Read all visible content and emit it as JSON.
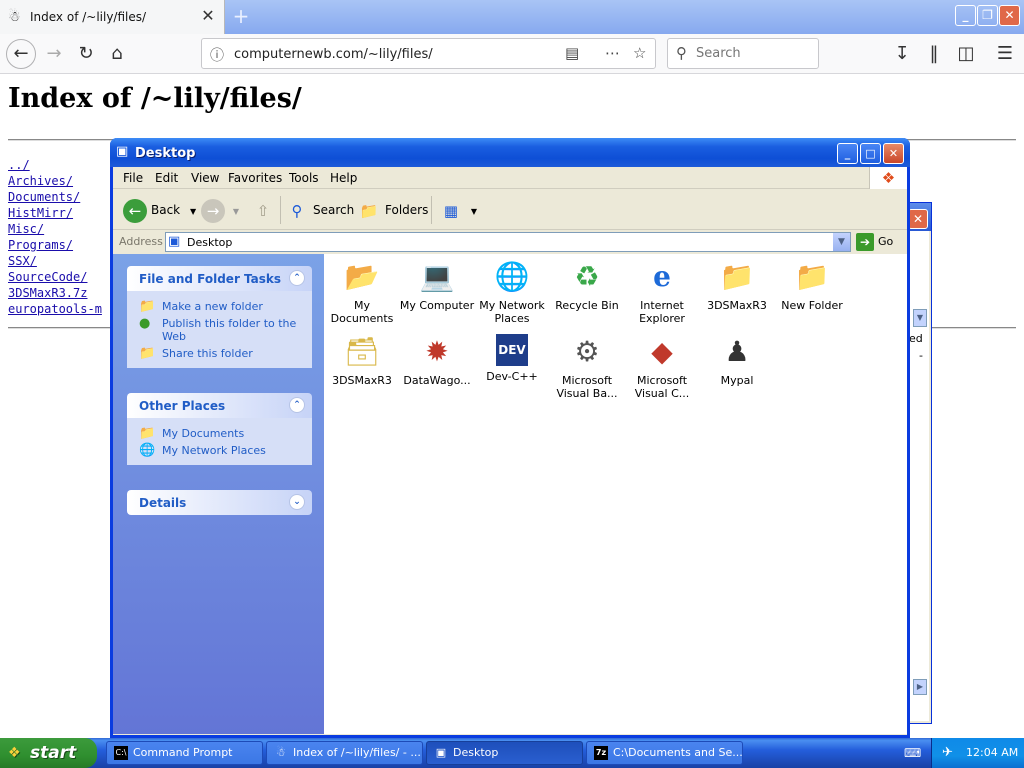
{
  "browser": {
    "tab_title": "Index of /~lily/files/",
    "url": "computernewb.com/~lily/files/",
    "search_placeholder": "Search",
    "page_heading": "Index of /~lily/files/",
    "listing": [
      "../",
      "Archives/",
      "Documents/",
      "HistMirr/",
      "Misc/",
      "Programs/",
      "SSX/",
      "SourceCode/",
      "3DSMaxR3.7z",
      "europatools-m"
    ]
  },
  "background_window": {
    "fragment_text_1": "ed",
    "fragment_text_2": "-"
  },
  "explorer": {
    "title": "Desktop",
    "menu": [
      "File",
      "Edit",
      "View",
      "Favorites",
      "Tools",
      "Help"
    ],
    "toolbar": {
      "back": "Back",
      "search": "Search",
      "folders": "Folders"
    },
    "address_label": "Address",
    "address_value": "Desktop",
    "go_label": "Go",
    "panels": {
      "tasks_title": "File and Folder Tasks",
      "tasks": [
        "Make a new folder",
        "Publish this folder to the Web",
        "Share this folder"
      ],
      "places_title": "Other Places",
      "places": [
        "My Documents",
        "My Network Places"
      ],
      "details_title": "Details"
    },
    "icons": [
      {
        "label": "My Documents",
        "icon": "folder-documents-icon"
      },
      {
        "label": "My Computer",
        "icon": "computer-icon"
      },
      {
        "label": "My Network Places",
        "icon": "network-places-icon"
      },
      {
        "label": "Recycle Bin",
        "icon": "recycle-bin-icon"
      },
      {
        "label": "Internet Explorer",
        "icon": "internet-explorer-icon"
      },
      {
        "label": "3DSMaxR3",
        "icon": "folder-icon"
      },
      {
        "label": "New Folder",
        "icon": "folder-icon"
      },
      {
        "label": "3DSMaxR3",
        "icon": "7z-archive-icon"
      },
      {
        "label": "DataWago...",
        "icon": "shortcut-icon"
      },
      {
        "label": "Dev-C++",
        "icon": "dev-cpp-icon"
      },
      {
        "label": "Microsoft Visual Ba...",
        "icon": "visual-basic-icon"
      },
      {
        "label": "Microsoft Visual C...",
        "icon": "visual-c-icon"
      },
      {
        "label": "Mypal",
        "icon": "mypal-icon"
      }
    ]
  },
  "taskbar": {
    "start_label": "start",
    "tasks": [
      "Command Prompt",
      "Index of /~lily/files/ - ...",
      "Desktop",
      "C:\\Documents and Se..."
    ],
    "active_task": "Desktop",
    "clock": "12:04 AM"
  }
}
